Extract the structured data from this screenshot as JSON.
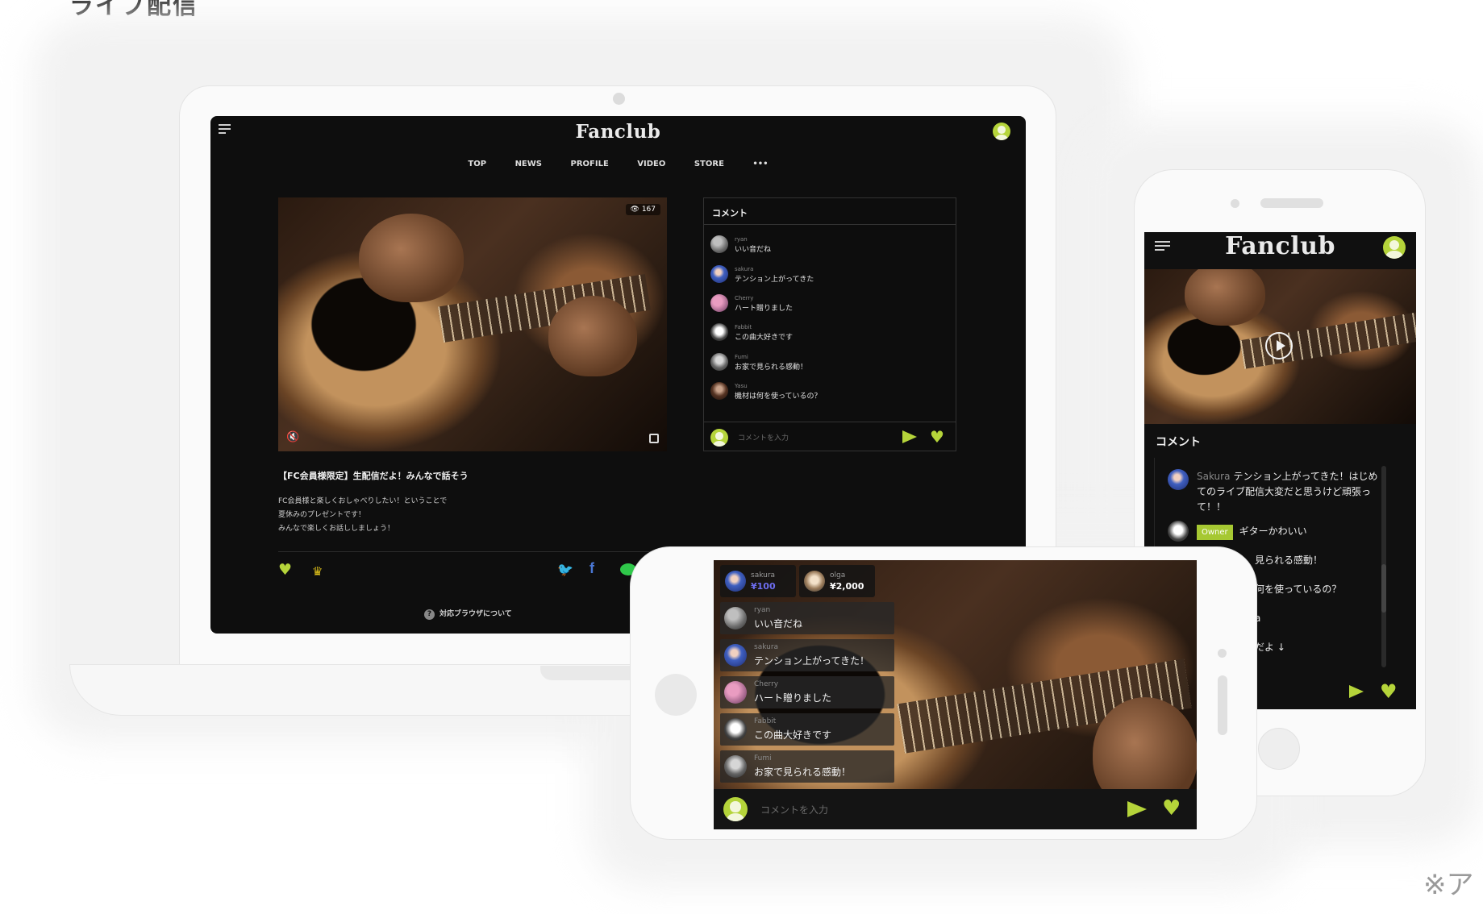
{
  "page": {
    "heading": "ライブ配信",
    "footnote": "※ア"
  },
  "brand": "Fanclub",
  "desktop": {
    "nav": [
      "TOP",
      "NEWS",
      "PROFILE",
      "VIDEO",
      "STORE",
      "•••"
    ],
    "view_count": "👁 167",
    "comment_title": "コメント",
    "comments": [
      {
        "name": "ryan",
        "text": "いい音だね",
        "avatar": "av-a"
      },
      {
        "name": "sakura",
        "text": "テンション上がってきた",
        "avatar": "av-b"
      },
      {
        "name": "Cherry",
        "text": "ハート贈りました",
        "avatar": "av-c"
      },
      {
        "name": "Fabbit",
        "text": "この曲大好きです",
        "avatar": "av-d"
      },
      {
        "name": "Fumi",
        "text": "お家で見られる感動！",
        "avatar": "av-e"
      },
      {
        "name": "Yasu",
        "text": "機材は何を使っているの？",
        "avatar": "av-f"
      }
    ],
    "comment_placeholder": "コメントを入力",
    "stream_title": "【FC会員様限定】生配信だよ！みんなで話そう",
    "stream_desc": [
      "FC会員様と楽しくおしゃべりしたい！ということで",
      "夏休みのプレゼントです！",
      "みんなで楽しくお話ししましょう！"
    ],
    "help": "対応ブラウザについて"
  },
  "portrait": {
    "comment_title": "コメント",
    "comments": [
      {
        "name": "Sakura",
        "text": "テンション上がってきた！はじめてのライブ配信大変だと思うけど頑張って！！"
      },
      {
        "badge": "Owner",
        "text": "ギターかわいい"
      },
      {
        "text": "見られる感動！"
      },
      {
        "text": "何を使っているの？"
      },
      {
        "text": "a"
      },
      {
        "text": "だよ ↓"
      }
    ]
  },
  "landscape": {
    "gifts": [
      {
        "name": "sakura",
        "amount": "¥100",
        "color": "#6d6df0",
        "avatar": "av-b"
      },
      {
        "name": "olga",
        "amount": "¥2,000",
        "color": "#ffffff",
        "avatar": "av-g"
      }
    ],
    "comments": [
      {
        "name": "ryan",
        "text": "いい音だね",
        "avatar": "av-a"
      },
      {
        "name": "sakura",
        "text": "テンション上がってきた！",
        "avatar": "av-b"
      },
      {
        "name": "Cherry",
        "text": "ハート贈りました",
        "avatar": "av-c"
      },
      {
        "name": "Fabbit",
        "text": "この曲大好きです",
        "avatar": "av-d"
      },
      {
        "name": "Fumi",
        "text": "お家で見られる感動！",
        "avatar": "av-e"
      }
    ],
    "comment_placeholder": "コメントを入力"
  },
  "colors": {
    "accent": "#b5d43a",
    "twitter": "#1da1f2",
    "facebook": "#4a77d4",
    "line": "#2fc84a",
    "crown": "#e0c21a"
  },
  "icons": [
    "menu-icon",
    "avatar-icon",
    "eye-icon",
    "mute-icon",
    "fullscreen-icon",
    "send-icon",
    "heart-icon",
    "crown-icon",
    "twitter-icon",
    "facebook-icon",
    "line-icon",
    "help-icon",
    "play-icon"
  ]
}
